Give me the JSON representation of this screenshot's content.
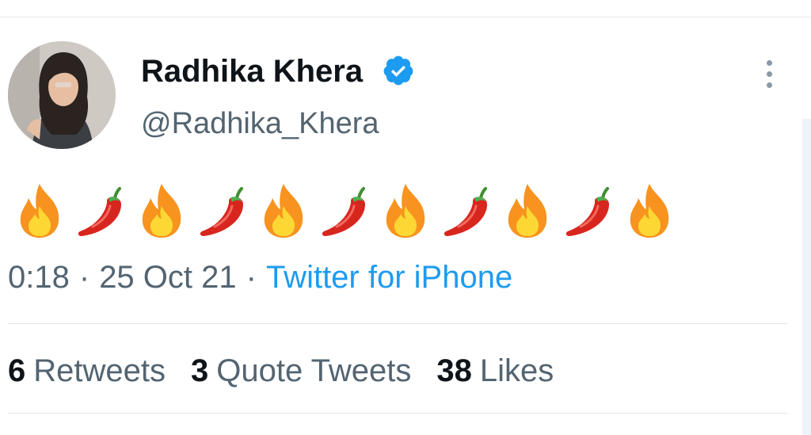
{
  "tweet": {
    "author": {
      "name": "Radhika Khera",
      "handle": "@Radhika_Khera",
      "verified": true
    },
    "body_icons": [
      "fire-icon",
      "chili-pepper-icon",
      "fire-icon",
      "chili-pepper-icon",
      "fire-icon",
      "chili-pepper-icon",
      "fire-icon",
      "chili-pepper-icon",
      "fire-icon",
      "chili-pepper-icon",
      "fire-icon"
    ],
    "meta": {
      "time": "0:18",
      "separator": "·",
      "date": "25 Oct 21",
      "source": "Twitter for iPhone"
    },
    "stats": {
      "retweets": {
        "count": "6",
        "label": "Retweets"
      },
      "quotes": {
        "count": "3",
        "label": "Quote Tweets"
      },
      "likes": {
        "count": "38",
        "label": "Likes"
      }
    }
  },
  "colors": {
    "text_primary": "#0f1419",
    "text_secondary": "#536471",
    "accent": "#1d9bf0",
    "divider": "#e1e6ea"
  }
}
